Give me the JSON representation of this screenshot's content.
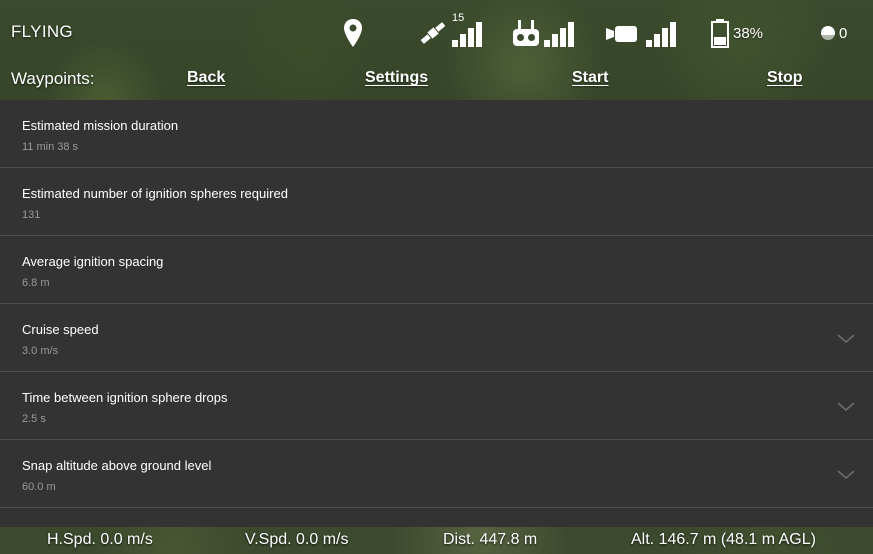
{
  "status_bar": {
    "flight_mode": "FLYING",
    "satellite_count": "15",
    "battery_percent": "38%",
    "other_count": "0",
    "icons": [
      "location-pin-icon",
      "satellite-icon",
      "remote-controller-icon",
      "video-camera-icon",
      "battery-icon",
      "spheres-icon"
    ]
  },
  "waypoints_bar": {
    "label": "Waypoints:",
    "back": "Back",
    "settings": "Settings",
    "start": "Start",
    "stop": "Stop"
  },
  "mission_settings": [
    {
      "label": "Estimated mission duration",
      "value": "11 min 38 s",
      "expandable": false
    },
    {
      "label": "Estimated number of ignition spheres required",
      "value": "131",
      "expandable": false
    },
    {
      "label": "Average ignition spacing",
      "value": "6.8 m",
      "expandable": false
    },
    {
      "label": "Cruise speed",
      "value": "3.0 m/s",
      "expandable": true
    },
    {
      "label": "Time between ignition sphere drops",
      "value": "2.5 s",
      "expandable": true
    },
    {
      "label": "Snap altitude above ground level",
      "value": "60.0 m",
      "expandable": true
    }
  ],
  "telemetry": {
    "h_speed": "H.Spd. 0.0 m/s",
    "v_speed": "V.Spd. 0.0 m/s",
    "distance": "Dist. 447.8 m",
    "altitude": "Alt. 146.7 m (48.1 m AGL)"
  },
  "colors": {
    "panel_background": "#333333",
    "row_divider": "#4d4d4d",
    "value_text": "#9a9a9a",
    "chevron": "#6e6e6e"
  }
}
